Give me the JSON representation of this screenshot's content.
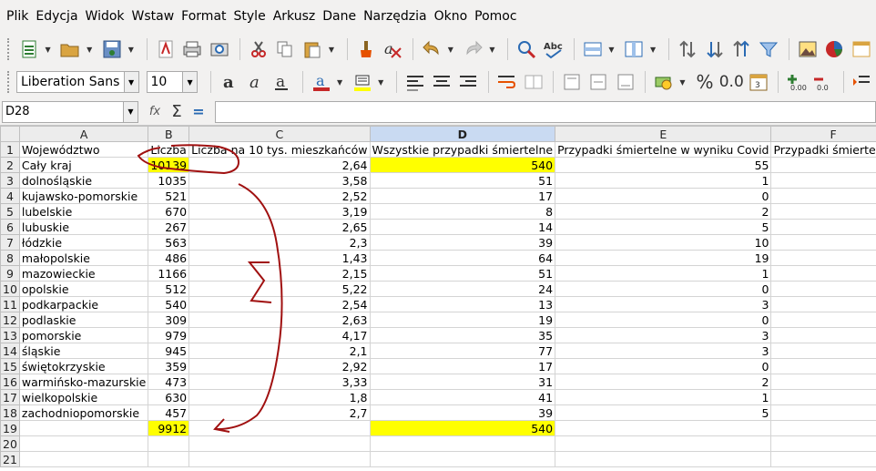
{
  "menu": [
    "Plik",
    "Edycja",
    "Widok",
    "Wstaw",
    "Format",
    "Style",
    "Arkusz",
    "Dane",
    "Narzędzia",
    "Okno",
    "Pomoc"
  ],
  "toolbar": {
    "font_name": "Liberation Sans",
    "font_size": "10",
    "percent_label": "%",
    "decimal_label": "0.0"
  },
  "formula_bar": {
    "cell_ref": "D28",
    "fx_label": "fx",
    "sigma_label": "Σ",
    "equals_label": "=",
    "content": ""
  },
  "columns": [
    "A",
    "B",
    "C",
    "D",
    "E",
    "F"
  ],
  "selected_column": "D",
  "rows": [
    {
      "n": "1",
      "a": "Województwo",
      "b": "Liczba",
      "c": "Liczba na 10 tys. mieszkańców",
      "d": "Wszystkie przypadki śmiertelne",
      "e": "Przypadki śmiertelne w wyniku Covid",
      "f": "Przypadki śmiertelne"
    },
    {
      "n": "2",
      "a": "Cały kraj",
      "b": "10139",
      "c": "2,64",
      "d": "540",
      "e": "55",
      "f": ""
    },
    {
      "n": "3",
      "a": "dolnośląskie",
      "b": "1035",
      "c": "3,58",
      "d": "51",
      "e": "1",
      "f": ""
    },
    {
      "n": "4",
      "a": "kujawsko-pomorskie",
      "b": "521",
      "c": "2,52",
      "d": "17",
      "e": "0",
      "f": ""
    },
    {
      "n": "5",
      "a": "lubelskie",
      "b": "670",
      "c": "3,19",
      "d": "8",
      "e": "2",
      "f": ""
    },
    {
      "n": "6",
      "a": "lubuskie",
      "b": "267",
      "c": "2,65",
      "d": "14",
      "e": "5",
      "f": ""
    },
    {
      "n": "7",
      "a": "łódzkie",
      "b": "563",
      "c": "2,3",
      "d": "39",
      "e": "10",
      "f": ""
    },
    {
      "n": "8",
      "a": "małopolskie",
      "b": "486",
      "c": "1,43",
      "d": "64",
      "e": "19",
      "f": ""
    },
    {
      "n": "9",
      "a": "mazowieckie",
      "b": "1166",
      "c": "2,15",
      "d": "51",
      "e": "1",
      "f": ""
    },
    {
      "n": "10",
      "a": "opolskie",
      "b": "512",
      "c": "5,22",
      "d": "24",
      "e": "0",
      "f": ""
    },
    {
      "n": "11",
      "a": "podkarpackie",
      "b": "540",
      "c": "2,54",
      "d": "13",
      "e": "3",
      "f": ""
    },
    {
      "n": "12",
      "a": "podlaskie",
      "b": "309",
      "c": "2,63",
      "d": "19",
      "e": "0",
      "f": ""
    },
    {
      "n": "13",
      "a": "pomorskie",
      "b": "979",
      "c": "4,17",
      "d": "35",
      "e": "3",
      "f": ""
    },
    {
      "n": "14",
      "a": "śląskie",
      "b": "945",
      "c": "2,1",
      "d": "77",
      "e": "3",
      "f": ""
    },
    {
      "n": "15",
      "a": "świętokrzyskie",
      "b": "359",
      "c": "2,92",
      "d": "17",
      "e": "0",
      "f": ""
    },
    {
      "n": "16",
      "a": "warmińsko-mazurskie",
      "b": "473",
      "c": "3,33",
      "d": "31",
      "e": "2",
      "f": ""
    },
    {
      "n": "17",
      "a": "wielkopolskie",
      "b": "630",
      "c": "1,8",
      "d": "41",
      "e": "1",
      "f": ""
    },
    {
      "n": "18",
      "a": "zachodniopomorskie",
      "b": "457",
      "c": "2,7",
      "d": "39",
      "e": "5",
      "f": ""
    },
    {
      "n": "19",
      "a": "",
      "b": "9912",
      "c": "",
      "d": "540",
      "e": "",
      "f": ""
    },
    {
      "n": "20",
      "a": "",
      "b": "",
      "c": "",
      "d": "",
      "e": "",
      "f": ""
    },
    {
      "n": "21",
      "a": "",
      "b": "",
      "c": "",
      "d": "",
      "e": "",
      "f": ""
    }
  ],
  "highlight_color": "#ffff00",
  "annotation_color": "#a01010"
}
